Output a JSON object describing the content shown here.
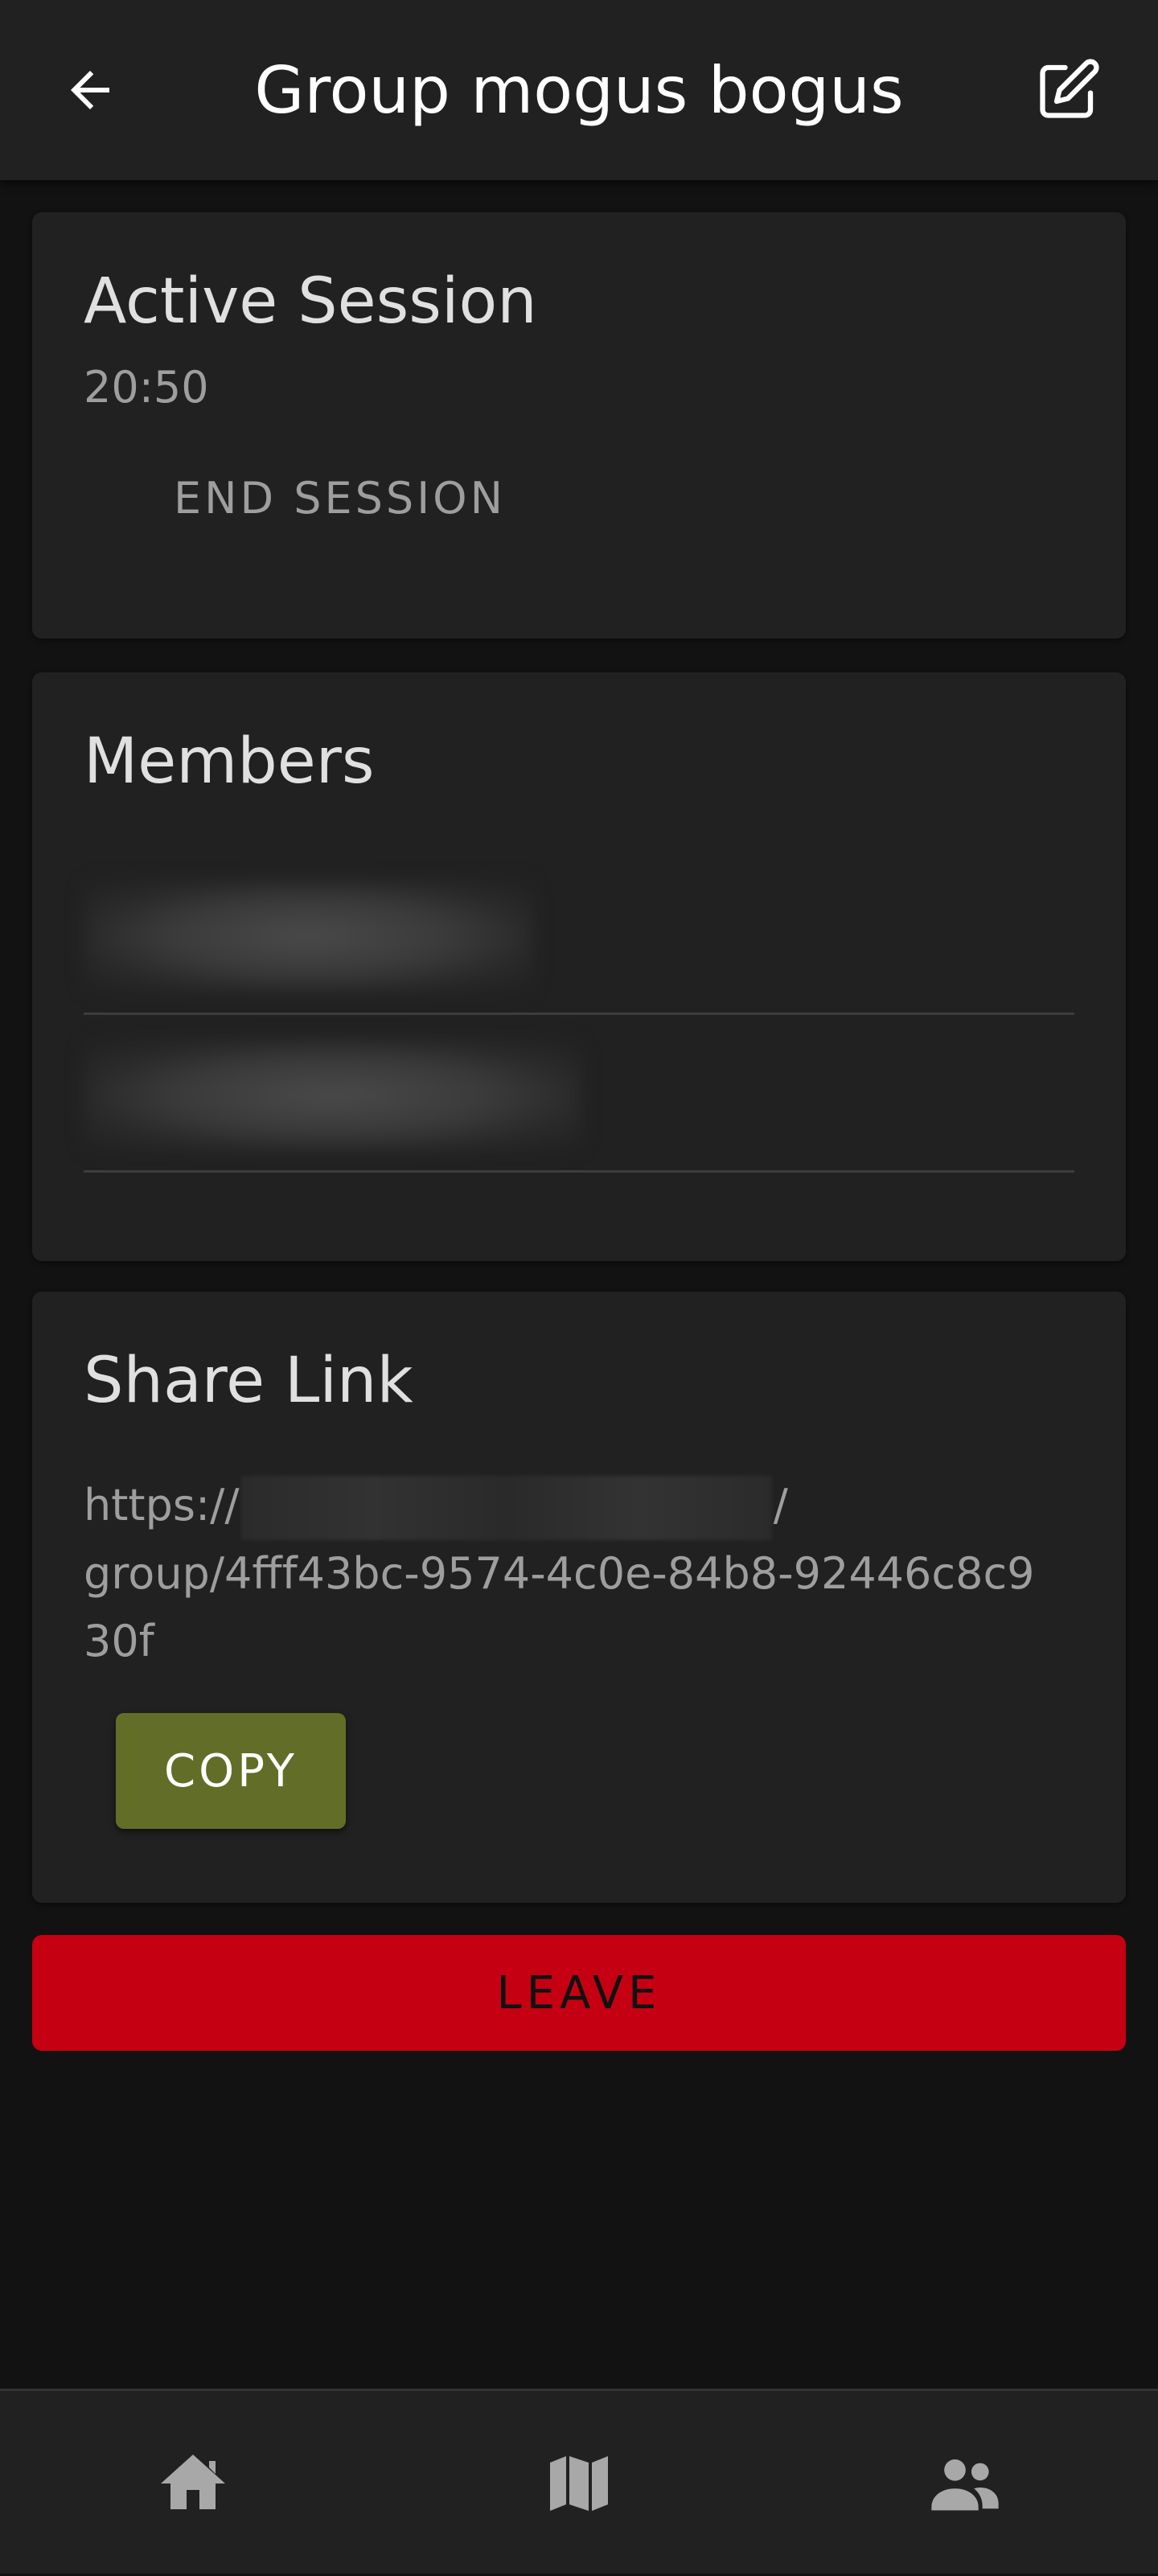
{
  "header": {
    "title": "Group mogus bogus",
    "back_icon": "arrow-left-icon",
    "edit_icon": "edit-icon"
  },
  "session": {
    "title": "Active Session",
    "time": "20:50",
    "end_label": "END SESSION"
  },
  "members": {
    "title": "Members",
    "items": [
      "",
      ""
    ]
  },
  "share": {
    "title": "Share Link",
    "link_prefix": "https://",
    "link_suffix": "/",
    "link_line2": "group/4fff43bc-9574-4c0e-84b8-92446c8c9",
    "link_line3": "30f",
    "copy_label": "COPY"
  },
  "leave_label": "LEAVE",
  "nav": {
    "items": [
      "home-icon",
      "map-icon",
      "group-icon"
    ]
  },
  "colors": {
    "background": "#121212",
    "surface": "#212121",
    "copy_button": "#626e28",
    "leave_button": "#c50012"
  }
}
